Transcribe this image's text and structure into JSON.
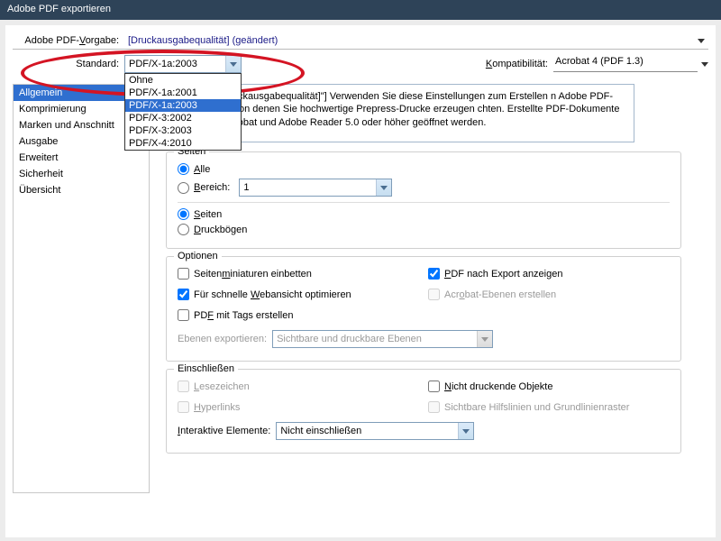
{
  "window": {
    "title": "Adobe PDF exportieren"
  },
  "preset": {
    "label_pre": "Adobe PDF-",
    "label_u": "V",
    "label_post": "orgabe:",
    "value": "[Druckausgabequalität] (geändert)"
  },
  "standard": {
    "label": "Standard:",
    "selected": "PDF/X-1a:2003",
    "options": [
      "Ohne",
      "PDF/X-1a:2001",
      "PDF/X-1a:2003",
      "PDF/X-3:2002",
      "PDF/X-3:2003",
      "PDF/X-4:2010"
    ]
  },
  "compat": {
    "label_u": "K",
    "label_post": "ompatibilität:",
    "value": "Acrobat 4 (PDF 1.3)"
  },
  "sidebar": {
    "items": [
      {
        "label": "Allgemein",
        "active": true
      },
      {
        "label": "Komprimierung"
      },
      {
        "label": "Marken und Anschnitt"
      },
      {
        "label": "Ausgabe"
      },
      {
        "label": "Erweitert"
      },
      {
        "label": "Sicherheit"
      },
      {
        "label": "Übersicht"
      }
    ]
  },
  "description": "asiert auf \"[Druckausgabequalität]\"] Verwenden Sie diese Einstellungen zum Erstellen n Adobe PDF-Dokumenten, von denen Sie hochwertige Prepress-Drucke erzeugen chten. Erstellte PDF-Dokumente können mit Acrobat und Adobe Reader 5.0 oder höher geöffnet werden.",
  "pages": {
    "group": "Seiten",
    "all_u": "A",
    "all_post": "lle",
    "range_u": "B",
    "range_post": "ereich:",
    "range_value": "1",
    "seiten_u": "S",
    "seiten_post": "eiten",
    "druck_u": "D",
    "druck_post": "ruckbögen"
  },
  "options": {
    "group": "Optionen",
    "miniaturen_pre": "Seiten",
    "miniaturen_u": "m",
    "miniaturen_post": "iniaturen einbetten",
    "pdfexport_u": "P",
    "pdfexport_post": "DF nach Export anzeigen",
    "web_pre": "Für schnelle ",
    "web_u": "W",
    "web_post": "ebansicht optimieren",
    "acroebenen_pre": "Acr",
    "acroebenen_u": "o",
    "acroebenen_post": "bat-Ebenen erstellen",
    "tags_pre": "PD",
    "tags_u": "F",
    "tags_post": " mit Tags erstellen",
    "ebenen_label": "Ebenen exportieren:",
    "ebenen_value": "Sichtbare und druckbare Ebenen"
  },
  "include": {
    "group": "Einschließen",
    "lesezeichen_u": "L",
    "lesezeichen_post": "esezeichen",
    "nichtdr_u": "N",
    "nichtdr_post": "icht druckende Objekte",
    "hyperlinks_u": "H",
    "hyperlinks_post": "yperlinks",
    "sichtbare": "Sichtbare Hilfslinien und Grundlinienraster",
    "interaktive_u": "I",
    "interaktive_post": "nteraktive Elemente:",
    "interaktive_value": "Nicht einschließen"
  }
}
